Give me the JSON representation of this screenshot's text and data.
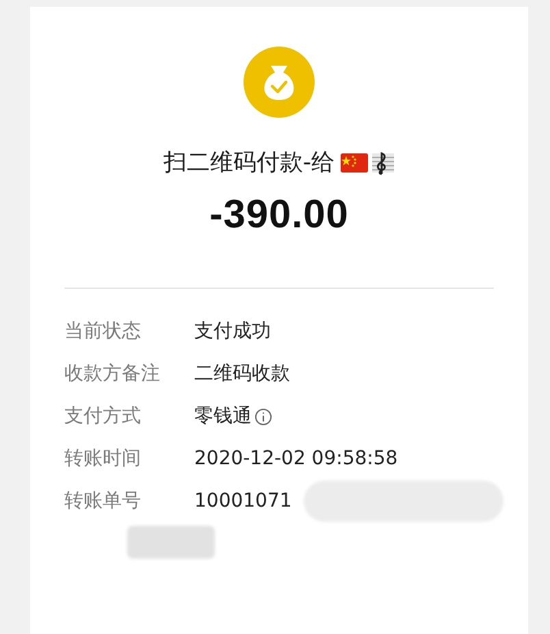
{
  "payment": {
    "title": "扫二维码付款-给",
    "amount": "-390.00"
  },
  "details": [
    {
      "label": "当前状态",
      "value": "支付成功",
      "info": false
    },
    {
      "label": "收款方备注",
      "value": "二维码收款",
      "info": false
    },
    {
      "label": "支付方式",
      "value": "零钱通",
      "info": true
    },
    {
      "label": "转账时间",
      "value": "2020-12-02 09:58:58",
      "info": false
    },
    {
      "label": "转账单号",
      "value": "10001071",
      "info": false
    }
  ]
}
